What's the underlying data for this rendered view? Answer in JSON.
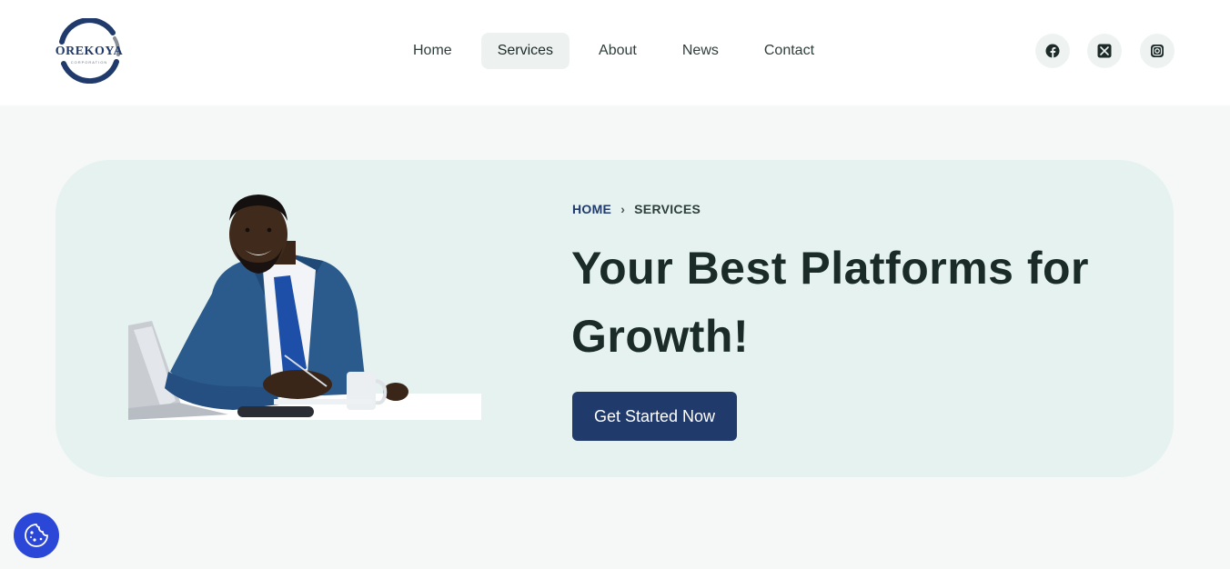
{
  "brand": {
    "name": "OREKOYA",
    "subtitle": "CORPORATION"
  },
  "nav": {
    "items": [
      {
        "label": "Home",
        "active": false
      },
      {
        "label": "Services",
        "active": true
      },
      {
        "label": "About",
        "active": false
      },
      {
        "label": "News",
        "active": false
      },
      {
        "label": "Contact",
        "active": false
      }
    ]
  },
  "social": [
    {
      "icon": "facebook-icon"
    },
    {
      "icon": "x-twitter-icon"
    },
    {
      "icon": "instagram-icon"
    }
  ],
  "hero": {
    "breadcrumb": {
      "home": "HOME",
      "separator": "›",
      "current": "SERVICES"
    },
    "title": "Your Best Platforms for Growth!",
    "cta_label": "Get Started Now",
    "image": "businessman-at-desk-photo"
  },
  "cookie": {
    "icon": "cookie-icon"
  },
  "colors": {
    "brand": "#1f3a6b",
    "hero_bg": "#e5f2f0",
    "cookie": "#2b47d8"
  }
}
